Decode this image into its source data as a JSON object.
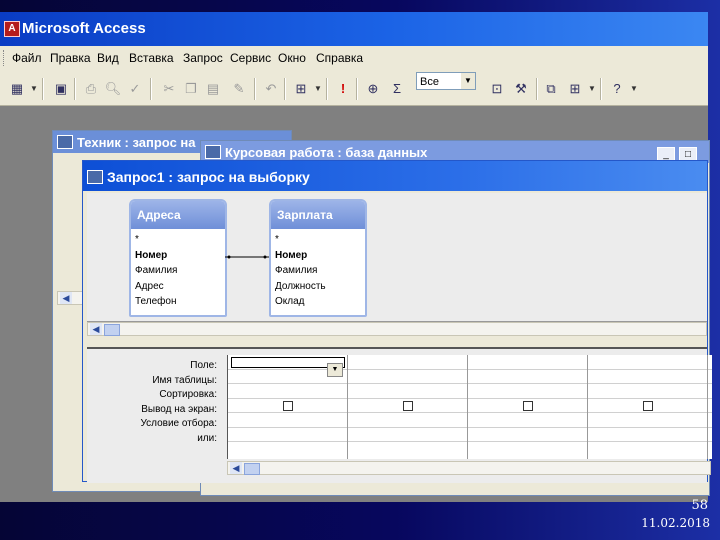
{
  "app": {
    "title": "Microsoft Access"
  },
  "menu": [
    "Файл",
    "Правка",
    "Вид",
    "Вставка",
    "Запрос",
    "Сервис",
    "Окно",
    "Справка"
  ],
  "toolbar": {
    "combo_value": "Все"
  },
  "windows": {
    "back": "Техник : запрос на",
    "middle": "Курсовая работа : база данных",
    "front": "Запрос1 : запрос на выборку"
  },
  "tables": [
    {
      "name": "Адреса",
      "fields": [
        "*",
        "Номер",
        "Фамилия",
        "Адрес",
        "Телефон"
      ]
    },
    {
      "name": "Зарплата",
      "fields": [
        "*",
        "Номер",
        "Фамилия",
        "Должность",
        "Оклад"
      ]
    }
  ],
  "grid": {
    "row_labels": [
      "Поле:",
      "Имя таблицы:",
      "Сортировка:",
      "Вывод на экран:",
      "Условие отбора:",
      "или:"
    ],
    "columns": 4
  },
  "slide": {
    "page": "58",
    "date": "11.02.2018"
  }
}
